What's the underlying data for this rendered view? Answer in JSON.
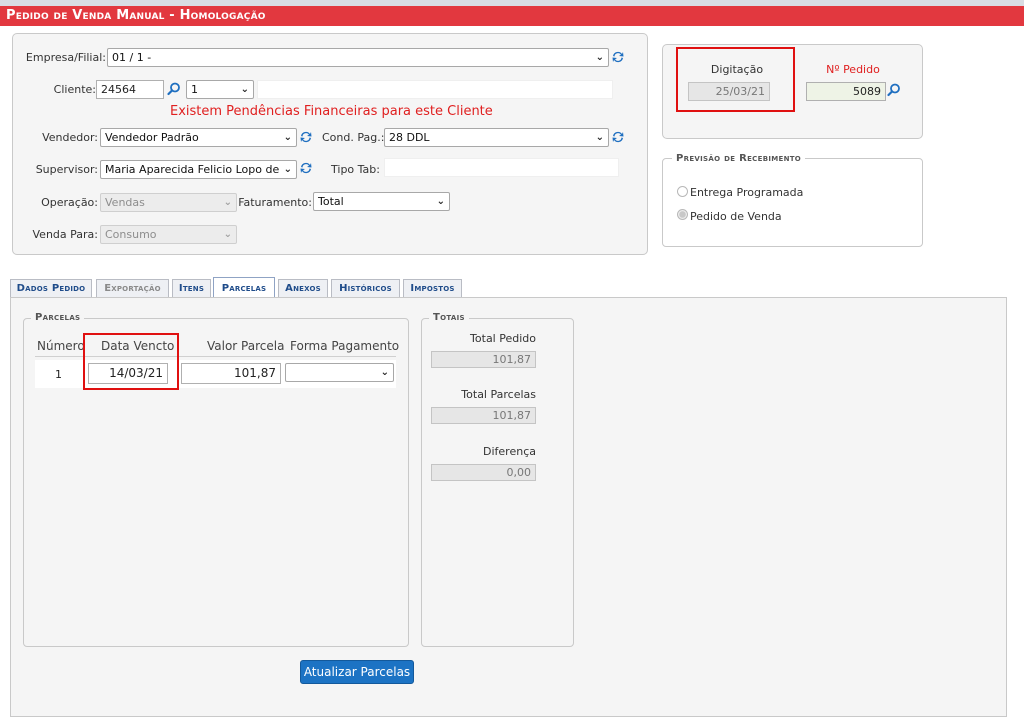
{
  "title": "Pedido de Venda Manual  - Homologação",
  "header": {
    "empresa_label": "Empresa/Filial:",
    "empresa_value": "01 / 1 -",
    "cliente_label": "Cliente:",
    "cliente_code": "24564",
    "cliente_sel": "1",
    "pendencias_msg": "Existem Pendências Financeiras para este Cliente",
    "vendedor_label": "Vendedor:",
    "vendedor_value": "Vendedor Padrão",
    "cond_pag_label": "Cond. Pag.:",
    "cond_pag_value": "28 DDL",
    "supervisor_label": "Supervisor:",
    "supervisor_value": "Maria Aparecida Felicio Lopo de S",
    "tipo_tab_label": "Tipo Tab:",
    "operacao_label": "Operação:",
    "operacao_value": "Vendas",
    "faturamento_label": "Faturamento:",
    "faturamento_value": "Total",
    "venda_para_label": "Venda Para:",
    "venda_para_value": "Consumo"
  },
  "right_panel": {
    "digitacao_label": "Digitação",
    "digitacao_value": "25/03/21",
    "pedido_label": "Nº Pedido",
    "pedido_value": "5089",
    "previsao_legend": "Previsão de Recebimento",
    "radio_entrega": "Entrega Programada",
    "radio_pedido": "Pedido de Venda"
  },
  "tabs": [
    {
      "label": "Dados Pedido"
    },
    {
      "label": "Exportação"
    },
    {
      "label": "Itens"
    },
    {
      "label": "Parcelas"
    },
    {
      "label": "Anexos"
    },
    {
      "label": "Históricos"
    },
    {
      "label": "Impostos"
    }
  ],
  "parcelas": {
    "legend": "Parcelas",
    "columns": [
      "Número",
      "Data Vencto",
      "Valor Parcela",
      "Forma Pagamento"
    ],
    "rows": [
      {
        "numero": "1",
        "data": "14/03/21",
        "valor": "101,87",
        "forma": ""
      }
    ]
  },
  "totais": {
    "legend": "Totais",
    "total_pedido_label": "Total Pedido",
    "total_pedido_value": "101,87",
    "total_parcelas_label": "Total Parcelas",
    "total_parcelas_value": "101,87",
    "diferenca_label": "Diferença",
    "diferenca_value": "0,00"
  },
  "actions": {
    "atualizar_label": "Atualizar Parcelas"
  },
  "colors": {
    "title_bg": "#e2383f",
    "accent": "#1c73c4",
    "highlight": "#e01010"
  }
}
